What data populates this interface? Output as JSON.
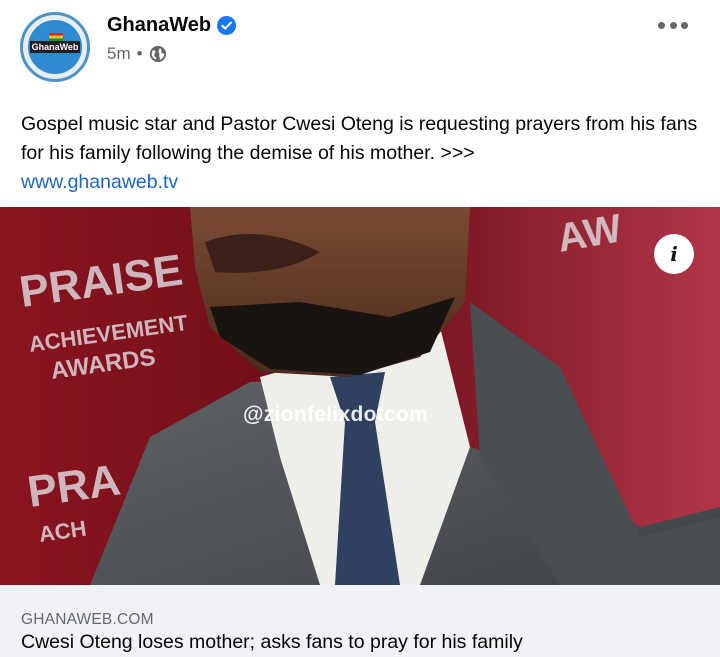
{
  "post": {
    "page_name": "GhanaWeb",
    "time": "5m",
    "separator": "•",
    "text": "Gospel music star and Pastor Cwesi Oteng is requesting prayers from his fans for his family following the demise of his mother. >>>",
    "link_text": "www.ghanaweb.tv",
    "avatar_logo_text": "GhanaWeb",
    "icons": {
      "verified": "verified-badge-icon",
      "privacy": "globe-icon",
      "more": "more-options-icon",
      "info": "info-icon"
    }
  },
  "media": {
    "watermark": "@zionfelixdotcom",
    "info_label": "i",
    "backdrop_text": [
      "PRAISE",
      "ACHIEVEMENT",
      "AWARDS"
    ]
  },
  "link_preview": {
    "domain": "GHANAWEB.COM",
    "headline": "Cwesi Oteng loses mother; asks fans to pray for his family"
  },
  "colors": {
    "link": "#1d66c9",
    "verified": "#1877f2",
    "secondary_text": "#65676b",
    "card_bg": "#f0f2f5"
  }
}
